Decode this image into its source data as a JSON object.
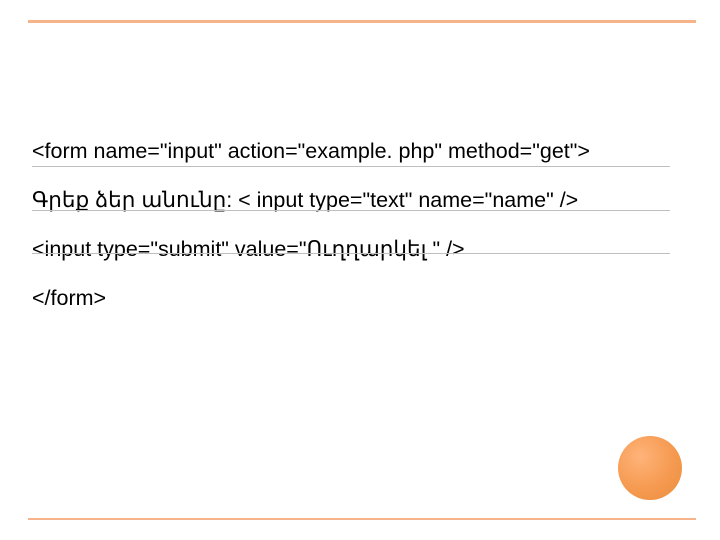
{
  "lines": {
    "l1": "<form name=\"input\" action=\"example. php\" method=\"get\">",
    "l2": "Գրեք ձեր անունը: <  input type=\"text\" name=\"name\" />",
    "l3": "<input type=\"submit\" value=\"Ուղղարկել \" />",
    "l4": "</form>"
  }
}
